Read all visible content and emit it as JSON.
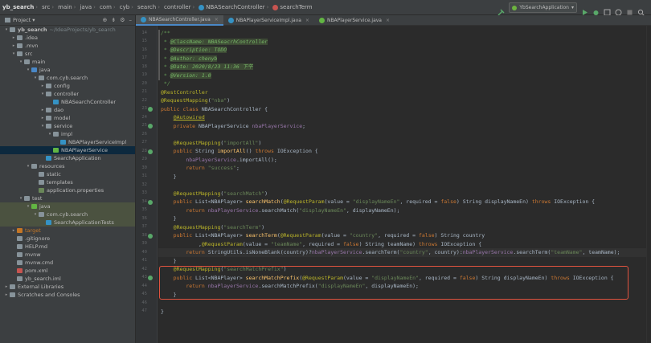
{
  "breadcrumbs": [
    "yb_search",
    "src",
    "main",
    "java",
    "com",
    "cyb",
    "search",
    "controller",
    "NBASearchController",
    "searchTerm"
  ],
  "run_config": {
    "label": "YbSearchApplication"
  },
  "project_panel": {
    "title": "Project"
  },
  "tree": [
    {
      "label": "yb_search",
      "sub": "~/IdeaProjects/yb_search",
      "depth": 0,
      "arrow": "▾",
      "color": "#87939a",
      "bold": true
    },
    {
      "label": ".idea",
      "depth": 1,
      "arrow": "▸",
      "color": "#87939a"
    },
    {
      "label": ".mvn",
      "depth": 1,
      "arrow": "▸",
      "color": "#87939a"
    },
    {
      "label": "src",
      "depth": 1,
      "arrow": "▾",
      "color": "#87939a"
    },
    {
      "label": "main",
      "depth": 2,
      "arrow": "▾",
      "color": "#87939a"
    },
    {
      "label": "java",
      "depth": 3,
      "arrow": "▾",
      "color": "#4a88c7"
    },
    {
      "label": "com.cyb.search",
      "depth": 4,
      "arrow": "▾",
      "color": "#87939a"
    },
    {
      "label": "config",
      "depth": 5,
      "arrow": "▸",
      "color": "#87939a"
    },
    {
      "label": "controller",
      "depth": 5,
      "arrow": "▾",
      "color": "#87939a"
    },
    {
      "label": "NBASearchController",
      "depth": 6,
      "arrow": "",
      "color": "#3592c4"
    },
    {
      "label": "dao",
      "depth": 5,
      "arrow": "▸",
      "color": "#87939a"
    },
    {
      "label": "model",
      "depth": 5,
      "arrow": "▸",
      "color": "#87939a"
    },
    {
      "label": "service",
      "depth": 5,
      "arrow": "▾",
      "color": "#87939a"
    },
    {
      "label": "impl",
      "depth": 6,
      "arrow": "▾",
      "color": "#87939a"
    },
    {
      "label": "NBAPlayerServiceImpl",
      "depth": 7,
      "arrow": "",
      "color": "#3592c4"
    },
    {
      "label": "NBAPlayerService",
      "depth": 6,
      "arrow": "",
      "color": "#62b543",
      "selected": true
    },
    {
      "label": "SearchApplication",
      "depth": 5,
      "arrow": "",
      "color": "#3592c4"
    },
    {
      "label": "resources",
      "depth": 3,
      "arrow": "▾",
      "color": "#87939a"
    },
    {
      "label": "static",
      "depth": 4,
      "arrow": "",
      "color": "#87939a"
    },
    {
      "label": "templates",
      "depth": 4,
      "arrow": "",
      "color": "#87939a"
    },
    {
      "label": "application.properties",
      "depth": 4,
      "arrow": "",
      "color": "#6a8759"
    },
    {
      "label": "test",
      "depth": 2,
      "arrow": "▾",
      "color": "#87939a"
    },
    {
      "label": "java",
      "depth": 3,
      "arrow": "▾",
      "color": "#62b543",
      "highlight": true
    },
    {
      "label": "com.cyb.search",
      "depth": 4,
      "arrow": "▾",
      "color": "#87939a",
      "highlight": true
    },
    {
      "label": "SearchApplicationTests",
      "depth": 5,
      "arrow": "",
      "color": "#3592c4",
      "highlight": true
    },
    {
      "label": "target",
      "depth": 1,
      "arrow": "▸",
      "color": "#c57625"
    },
    {
      "label": ".gitignore",
      "depth": 1,
      "arrow": "",
      "color": "#87939a"
    },
    {
      "label": "HELP.md",
      "depth": 1,
      "arrow": "",
      "color": "#87939a"
    },
    {
      "label": "mvnw",
      "depth": 1,
      "arrow": "",
      "color": "#87939a"
    },
    {
      "label": "mvnw.cmd",
      "depth": 1,
      "arrow": "",
      "color": "#87939a"
    },
    {
      "label": "pom.xml",
      "depth": 1,
      "arrow": "",
      "color": "#c75450"
    },
    {
      "label": "yb_search.iml",
      "depth": 1,
      "arrow": "",
      "color": "#87939a"
    },
    {
      "label": "External Libraries",
      "depth": 0,
      "arrow": "▸",
      "color": "#87939a"
    },
    {
      "label": "Scratches and Consoles",
      "depth": 0,
      "arrow": "▸",
      "color": "#87939a"
    }
  ],
  "tabs": [
    {
      "label": "NBASearchController.java",
      "active": true,
      "color": "#3592c4"
    },
    {
      "label": "NBAPlayerServiceImpl.java",
      "active": false,
      "color": "#3592c4"
    },
    {
      "label": "NBAPlayerService.java",
      "active": false,
      "color": "#62b543"
    }
  ],
  "gutter": {
    "first_line": 14,
    "line_count": 34
  },
  "code_lines": [
    "<span class=\"c\">/**</span>",
    "<span class=\"c\"> * <span class=\"dt\">@ClassName: NBASeacrhController</span></span>",
    "<span class=\"c\"> * <span class=\"dt\">@Description: TODO</span></span>",
    "<span class=\"c\"> * <span class=\"dt\">@Author: chenyb</span></span>",
    "<span class=\"c\"> * <span class=\"dt\">@Date: 2020/8/23 11:36 下午</span></span>",
    "<span class=\"c\"> * <span class=\"dt\">@Version: 1.0</span></span>",
    "<span class=\"c\"> */</span>",
    "<span class=\"a\">@RestController</span>",
    "<span class=\"a\">@RequestMapping</span>(<span class=\"s\">\"nba\"</span>)",
    "<span class=\"k\">public class</span> NBASearchController {",
    "    <span class=\"a u\">@Autowired</span>",
    "    <span class=\"k\">private</span> NBAPlayerService <span class=\"f\">nbaPlayerService</span>;",
    "",
    "    <span class=\"a\">@RequestMapping</span>(<span class=\"s\">\"importAll\"</span>)",
    "    <span class=\"k\">public</span> String <span class=\"m\">importAll</span>() <span class=\"k\">throws</span> IOException {",
    "        <span class=\"f\">nbaPlayerService</span>.importAll();",
    "        <span class=\"k\">return</span> <span class=\"s\">\"success\"</span>;",
    "    }",
    "",
    "    <span class=\"a\">@RequestMapping</span>(<span class=\"s\">\"searchMatch\"</span>)",
    "    <span class=\"k\">public</span> List&lt;NBAPlayer&gt; <span class=\"m\">searchMatch</span>(<span class=\"a\">@RequestParam</span>(value = <span class=\"s\">\"displayNameEn\"</span>, required = <span class=\"k\">false</span>) String displayNameEn) <span class=\"k\">throws</span> IOException {",
    "        <span class=\"k\">return</span> <span class=\"f\">nbaPlayerService</span>.searchMatch(<span class=\"s\">\"displayNameEn\"</span>, displayNameEn);",
    "    }",
    "    <span class=\"a\">@RequestMapping</span>(<span class=\"s\">\"searchTerm\"</span>)",
    "    <span class=\"k\">public</span> List&lt;NBAPlayer&gt; <span class=\"m\">searchTerm</span>(<span class=\"a\">@RequestParam</span>(value = <span class=\"s\">\"country\"</span>, required = <span class=\"k\">false</span>) String country",
    "            ,<span class=\"a\">@RequestParam</span>(value = <span class=\"s\">\"teamName\"</span>, required = <span class=\"k\">false</span>) String teamName) <span class=\"k\">throws</span> IOException {",
    "        <span class=\"k\">return</span> StringUtils.<span class=\"i\">isNoneBlank</span>(country)?<span class=\"f\">nbaPlayerService</span>.searchTerm(<span class=\"s\">\"country\"</span>, country):<span class=\"f\">nbaPlayerService</span>.searchTerm(<span class=\"s\">\"teamName\"</span>, teamName);",
    "    }",
    "    <span class=\"a\">@RequestMapping</span>(<span class=\"s\">\"searchMatchPrefix\"</span>)",
    "    <span class=\"k\">public</span> List&lt;NBAPlayer&gt; <span class=\"m\">searchMatchPrefix</span>(<span class=\"a\">@RequestParam</span>(value = <span class=\"s\">\"displayNameEn\"</span>, required = <span class=\"k\">false</span>) String displayNameEn) <span class=\"k\">throws</span> IOException {",
    "        <span class=\"k\">return</span> <span class=\"f\">nbaPlayerService</span>.searchMatchPrefix(<span class=\"s\">\"displayNameEn\"</span>, displayNameEn);",
    "    }",
    "",
    "}"
  ],
  "current_line_index": 26,
  "highlight_box": {
    "label": "searchMatchPrefix method (highlighted)"
  }
}
